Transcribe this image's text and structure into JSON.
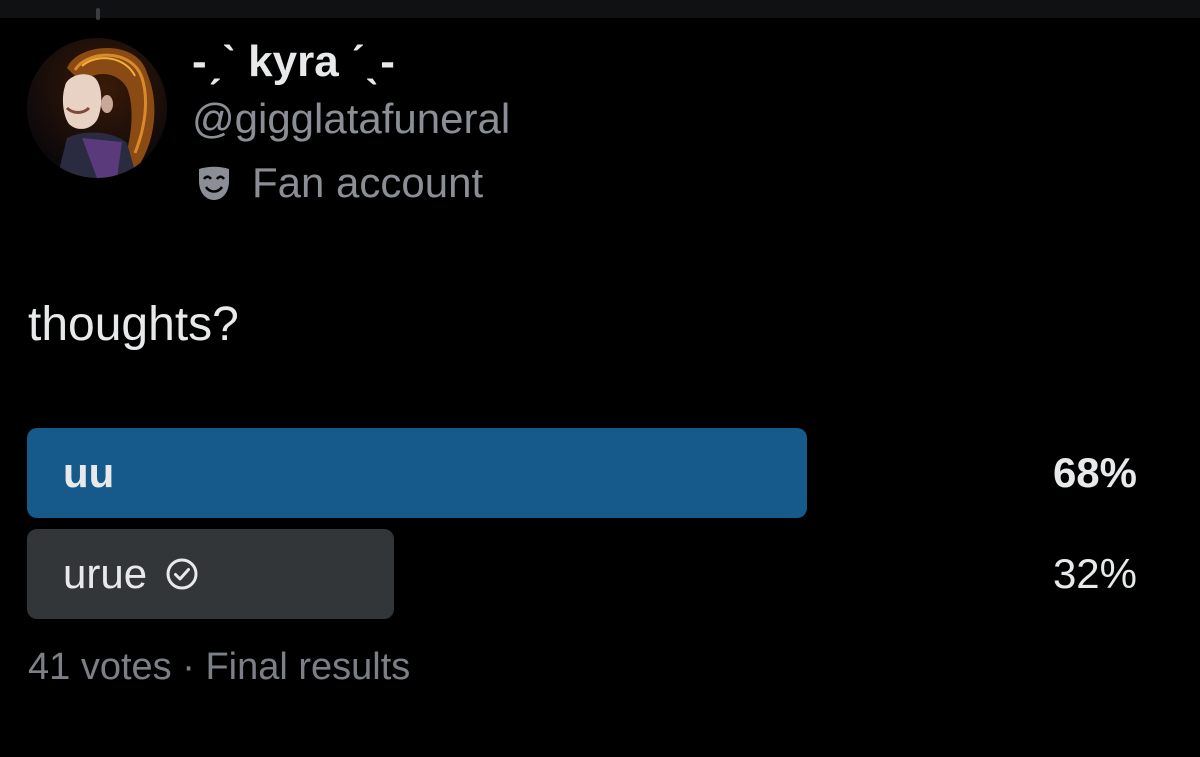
{
  "author": {
    "display_name": "-ˏˋ kyra ˊˎ-",
    "handle": "@gigglatafuneral",
    "label_icon": "theater-mask-icon",
    "label_text": "Fan account"
  },
  "post": {
    "text": "thoughts?"
  },
  "poll": {
    "options": [
      {
        "label": "uu",
        "percent_text": "68%",
        "share": 0.68,
        "winner": true,
        "bar_color": "#155a8a"
      },
      {
        "label": "urue",
        "percent_text": "32%",
        "share": 0.32,
        "winner": false,
        "bar_color": "#333639",
        "icon": "check-circle-icon"
      }
    ],
    "votes": "41 votes",
    "separator": "·",
    "status": "Final results"
  },
  "colors": {
    "background": "#000000",
    "text_primary": "#e7e9ea",
    "text_secondary": "#8b8f95",
    "winner_bar": "#155a8a",
    "other_bar": "#333639"
  }
}
